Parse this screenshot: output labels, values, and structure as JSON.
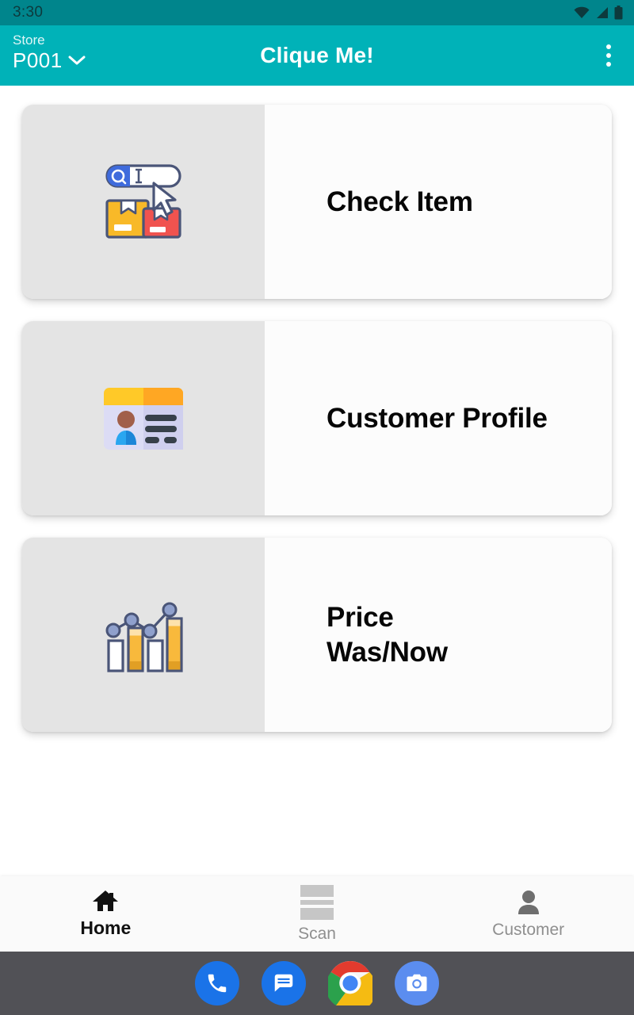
{
  "status_bar": {
    "time": "3:30",
    "icons": [
      "wifi-icon",
      "signal-icon",
      "battery-icon"
    ]
  },
  "app_bar": {
    "store_label": "Store",
    "store_value": "P001",
    "store_chevron": "chevron-down-icon",
    "title": "Clique Me!",
    "overflow_icon": "more-vertical-icon",
    "background_color": "#00b2b8",
    "status_background_color": "#00858c"
  },
  "menu_cards": [
    {
      "title": "Check Item",
      "icon": "search-boxes-icon",
      "wrap": false
    },
    {
      "title": "Customer Profile",
      "icon": "id-card-icon",
      "wrap": false
    },
    {
      "title": "Price Was/Now",
      "icon": "bar-chart-icon",
      "wrap": true
    }
  ],
  "bottom_nav": [
    {
      "label": "Home",
      "icon": "home-icon",
      "active": true
    },
    {
      "label": "Scan",
      "icon": "barcode-scan-icon",
      "active": false
    },
    {
      "label": "Customer",
      "icon": "person-icon",
      "active": false
    }
  ],
  "dock": [
    {
      "name": "phone-app",
      "icon": "phone-icon"
    },
    {
      "name": "messages-app",
      "icon": "message-icon"
    },
    {
      "name": "chrome-app",
      "icon": "chrome-icon"
    },
    {
      "name": "camera-app",
      "icon": "camera-icon"
    }
  ]
}
